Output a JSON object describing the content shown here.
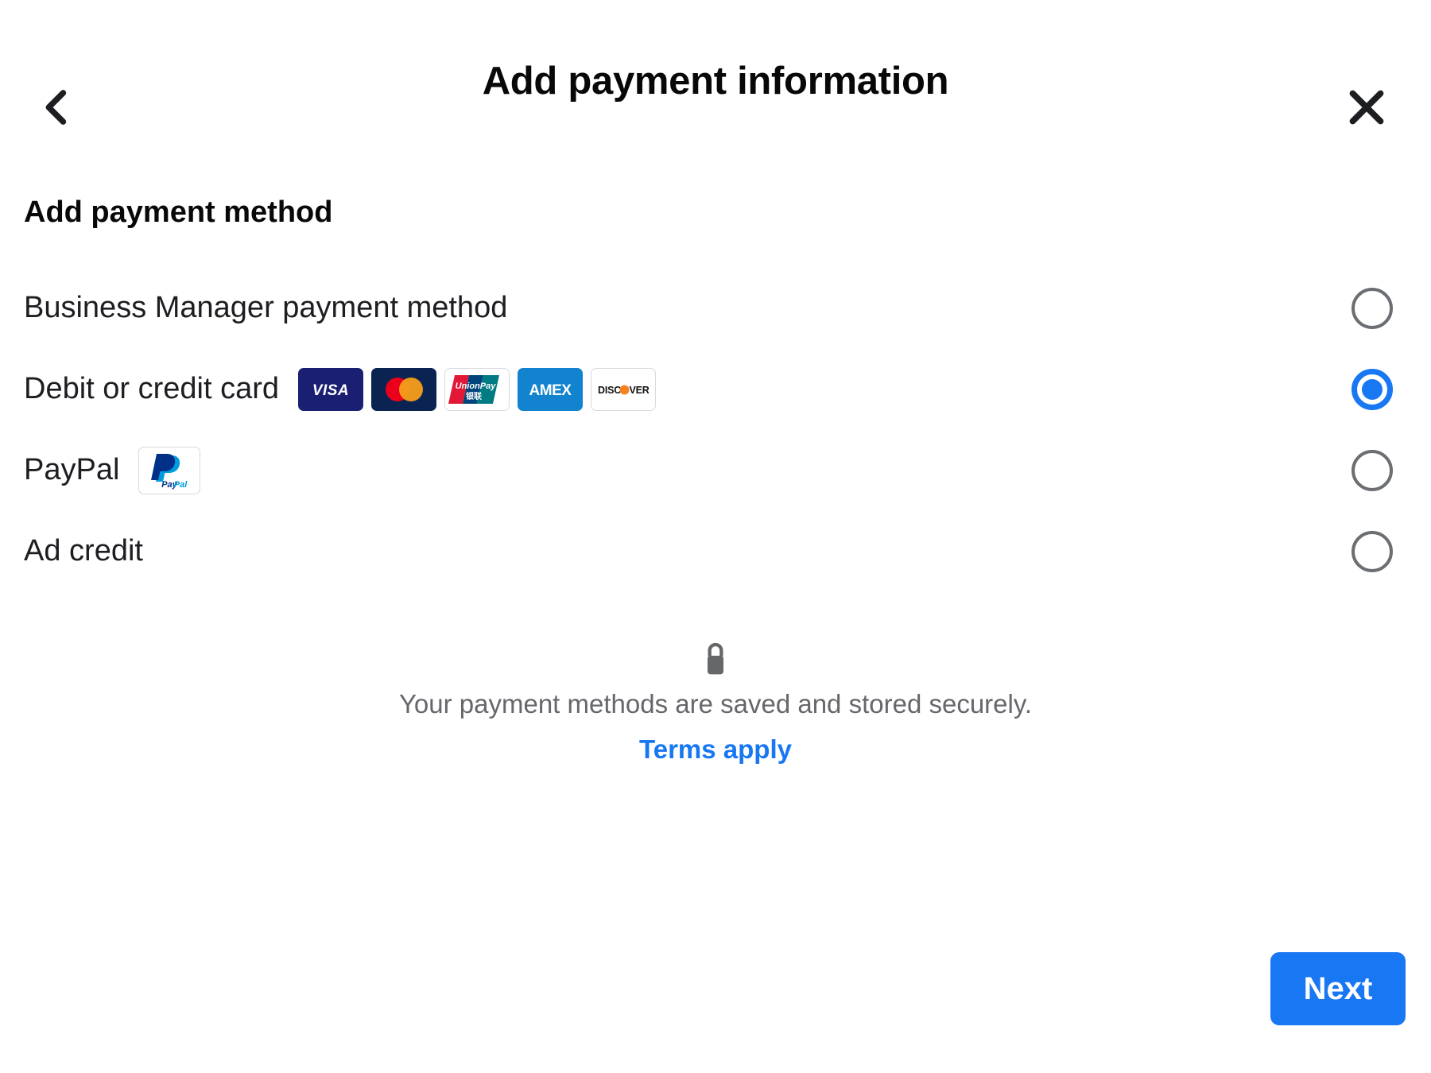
{
  "header": {
    "title": "Add payment information",
    "back_icon": "chevron-left-icon",
    "close_icon": "close-icon"
  },
  "main": {
    "section_heading": "Add payment method",
    "options": [
      {
        "label": "Business Manager payment method",
        "selected": false,
        "logos": []
      },
      {
        "label": "Debit or credit card",
        "selected": true,
        "logos": [
          "visa-logo",
          "mastercard-logo",
          "unionpay-logo",
          "amex-logo",
          "discover-logo"
        ]
      },
      {
        "label": "PayPal",
        "selected": false,
        "logos": [
          "paypal-logo"
        ]
      },
      {
        "label": "Ad credit",
        "selected": false,
        "logos": []
      }
    ],
    "card_logo_text": {
      "visa": "VISA",
      "unionpay": "UnionPay",
      "unionpay_cn": "银联",
      "amex": "AMEX",
      "discover_before": "DISC",
      "discover_after": "VER",
      "paypal": "PayPal"
    },
    "secure": {
      "icon": "lock-icon",
      "text": "Your payment methods are saved and stored securely.",
      "terms_link": "Terms apply"
    }
  },
  "footer": {
    "next_label": "Next"
  },
  "colors": {
    "accent_blue": "#1877f2",
    "text_primary": "#1c1e21",
    "text_secondary": "#65676b",
    "visa_navy": "#1a1f71",
    "mastercard_navy": "#0a2351",
    "mastercard_red": "#eb001b",
    "mastercard_orange": "#f79e1b",
    "amex_blue": "#1283ce",
    "unionpay_red": "#e21836",
    "unionpay_blue": "#00447c",
    "unionpay_teal": "#007b84",
    "discover_orange": "#f68121",
    "paypal_dark": "#003087",
    "paypal_light": "#009cde"
  }
}
